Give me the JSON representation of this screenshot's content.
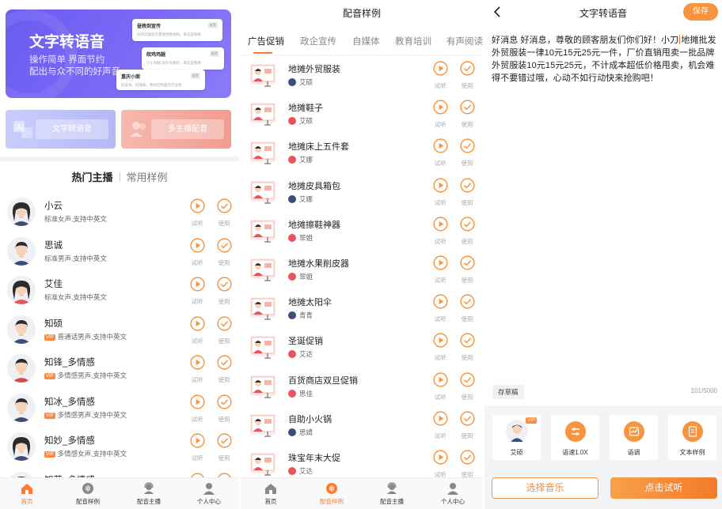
{
  "home": {
    "banner": {
      "title": "文字转语音",
      "sub1": "操作简单 界面节约",
      "sub2": "配出与众不同的好声音",
      "cards": [
        {
          "title": "昼晚到宣传",
          "line": "您的店铺是否需要昼晚视频，来这里看看",
          "tag": "配音"
        },
        {
          "title": "皖鸡鸡腿",
          "line": "小小鸡腿·好好肯德鸡，来这里看看",
          "tag": "配音"
        },
        {
          "title": "重庆小面",
          "line": "好美食，好滋味，我的吃鸭面店开业啦",
          "tag": "配音"
        }
      ]
    },
    "tiles": {
      "tts": "文字转语音",
      "multi": "多主播配音"
    },
    "segment": {
      "hot": "热门主播",
      "common": "常用样例"
    },
    "anchors": [
      {
        "name": "小云",
        "desc": "标准女声,支持中英文",
        "vip": false,
        "gender": "f"
      },
      {
        "name": "思诚",
        "desc": "标准男声,支持中英文",
        "vip": false,
        "gender": "m"
      },
      {
        "name": "艾佳",
        "desc": "标准女声,支持中英文",
        "vip": false,
        "gender": "f2"
      },
      {
        "name": "知硕",
        "desc": "普通话男声,支持中英文",
        "vip": true,
        "gender": "m"
      },
      {
        "name": "知锋_多情感",
        "desc": "多情感男声,支持中英文",
        "vip": true,
        "gender": "m2"
      },
      {
        "name": "知冰_多情感",
        "desc": "多情感男声,支持中英文",
        "vip": true,
        "gender": "m"
      },
      {
        "name": "知妙_多情感",
        "desc": "多情感女声,支持中英文",
        "vip": true,
        "gender": "f"
      },
      {
        "name": "知莎_多情感",
        "desc": "",
        "vip": false,
        "gender": "f2"
      }
    ],
    "actions": {
      "listen": "试听",
      "use": "使用"
    },
    "vip_label": "VIP"
  },
  "samples": {
    "title": "配音样例",
    "tabs": [
      "广告促销",
      "政企宣传",
      "自媒体",
      "教育培训",
      "有声阅读"
    ],
    "items": [
      {
        "name": "地摊外贸服装",
        "voice": "艾硕"
      },
      {
        "name": "地摊鞋子",
        "voice": "艾硕"
      },
      {
        "name": "地摊床上五件套",
        "voice": "艾娜"
      },
      {
        "name": "地摊皮具箱包",
        "voice": "艾娜"
      },
      {
        "name": "地摊擦鞋神器",
        "voice": "翠姐"
      },
      {
        "name": "地摊水果削皮器",
        "voice": "翠姐"
      },
      {
        "name": "地摊太阳伞",
        "voice": "青青"
      },
      {
        "name": "圣诞促销",
        "voice": "艾达"
      },
      {
        "name": "百货商店双旦促销",
        "voice": "思佳"
      },
      {
        "name": "自助小火锅",
        "voice": "思婧"
      },
      {
        "name": "珠宝年末大促",
        "voice": "艾达"
      }
    ]
  },
  "tabbar": [
    "首页",
    "配音样例",
    "配音主播",
    "个人中心"
  ],
  "editor": {
    "title": "文字转语音",
    "save": "保存",
    "text_before": "好消息 好消息，尊敬的顾客朋友们你们好！小刀",
    "text_after": "地摊批发外贸服装一律10元15元25元一件，厂价直销甩卖一批品牌外贸服装10元15元25元，不计成本超低价格甩卖，机会难得不要错过哦，心动不如行动快来抢购吧！",
    "draft": "存草稿",
    "counter": "101/5000",
    "options": [
      {
        "label": "艾硕",
        "vip": true
      },
      {
        "label": "语速1.0X"
      },
      {
        "label": "语调"
      },
      {
        "label": "文本样例"
      }
    ],
    "music": "选择音乐",
    "try": "点击试听"
  },
  "colors": {
    "accent": "#f7943f",
    "banner": "#6a5cf0"
  }
}
